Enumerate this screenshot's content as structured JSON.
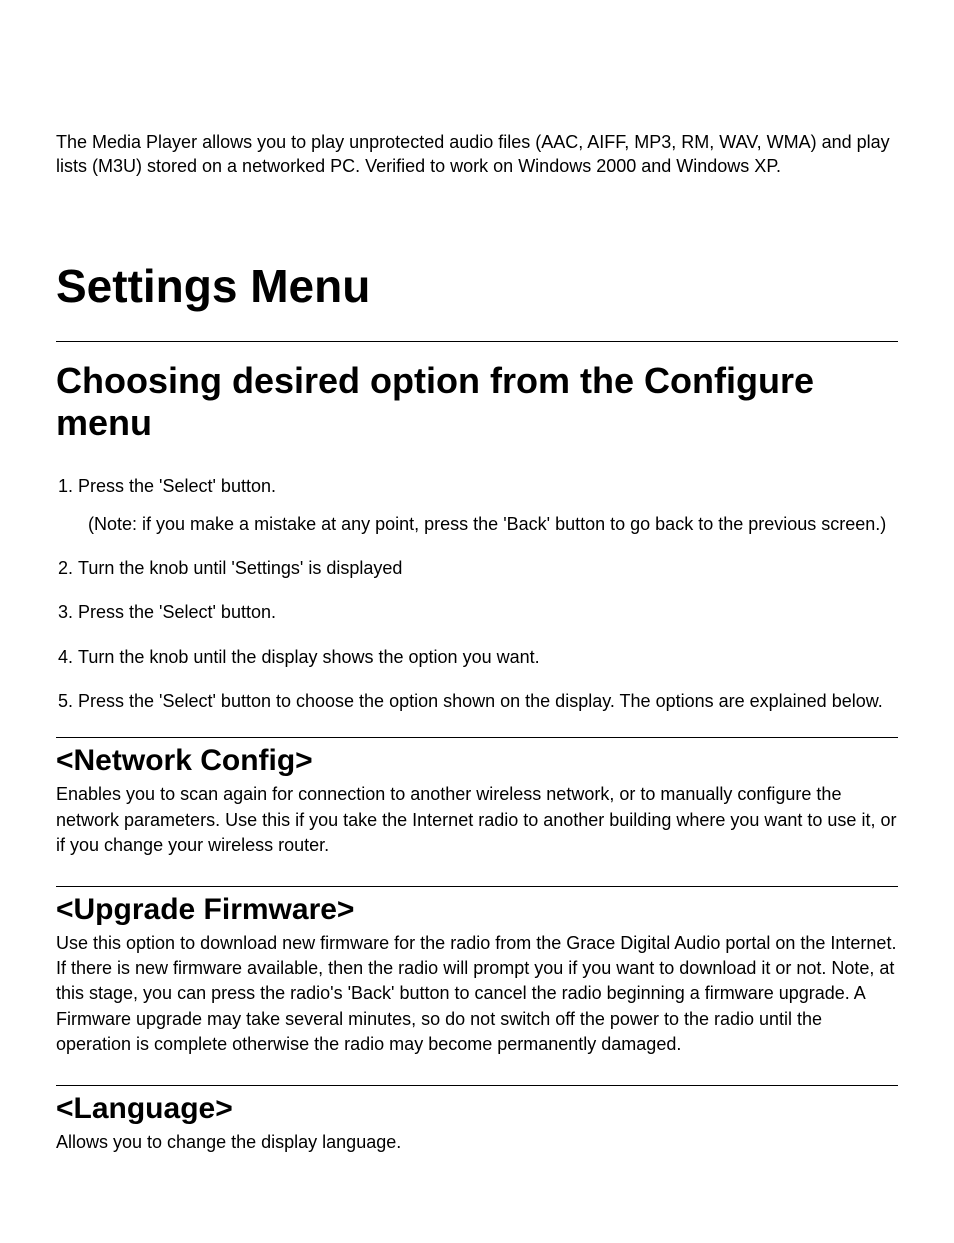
{
  "intro": "The Media Player allows you to play unprotected audio files (AAC, AIFF, MP3, RM, WAV, WMA) and play lists (M3U) stored on a networked PC. Verified to work on Windows 2000 and Windows XP.",
  "main_title": "Settings Menu",
  "sub_title": "Choosing desired option from the Configure menu",
  "steps": [
    {
      "text": "Press the 'Select' button.",
      "note": "(Note: if you make a mistake at any point, press the 'Back' button to go back to the previous screen.)"
    },
    {
      "text": "Turn the knob until 'Settings' is displayed"
    },
    {
      "text": "Press the 'Select' button."
    },
    {
      "text": "Turn the knob until the display shows the option you want."
    },
    {
      "text": "Press the 'Select' button to choose the option shown on the display. The options are explained below."
    }
  ],
  "sections": [
    {
      "heading": "<Network Config>",
      "body": "Enables you to scan again for connection to another wireless network, or to manually configure the network parameters. Use this if you take the Internet radio to another building where you want to use it, or if you change your wireless router."
    },
    {
      "heading": "<Upgrade Firmware>",
      "body": "Use this option to download new firmware for the radio from the Grace Digital Audio portal on the Internet. If there is new firmware available, then the radio will prompt you if you want to download it or not. Note, at this stage, you can press the radio's 'Back' button to cancel the radio beginning a firmware upgrade. A Firmware upgrade may take several minutes, so do not switch off the power to the radio until the operation is complete otherwise the radio may become permanently damaged."
    },
    {
      "heading": "<Language>",
      "body": "Allows you to change the display language."
    }
  ]
}
